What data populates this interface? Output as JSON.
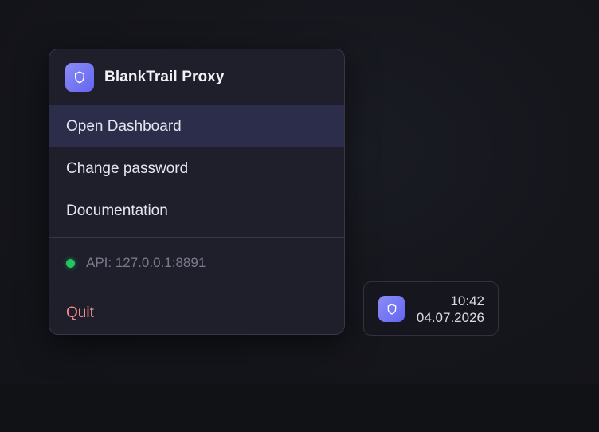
{
  "app": {
    "title": "BlankTrail Proxy",
    "icon": "shield-icon",
    "accent": "#6366f1"
  },
  "menu": {
    "items": [
      {
        "label": "Open Dashboard",
        "active": true
      },
      {
        "label": "Change password",
        "active": false
      },
      {
        "label": "Documentation",
        "active": false
      }
    ],
    "status": {
      "text": "API: 127.0.0.1:8891",
      "color": "#22c55e"
    },
    "quit_label": "Quit",
    "quit_color": "#f08a8e"
  },
  "tray": {
    "icon": "shield-icon",
    "time": "10:42",
    "date": "04.07.2026"
  }
}
